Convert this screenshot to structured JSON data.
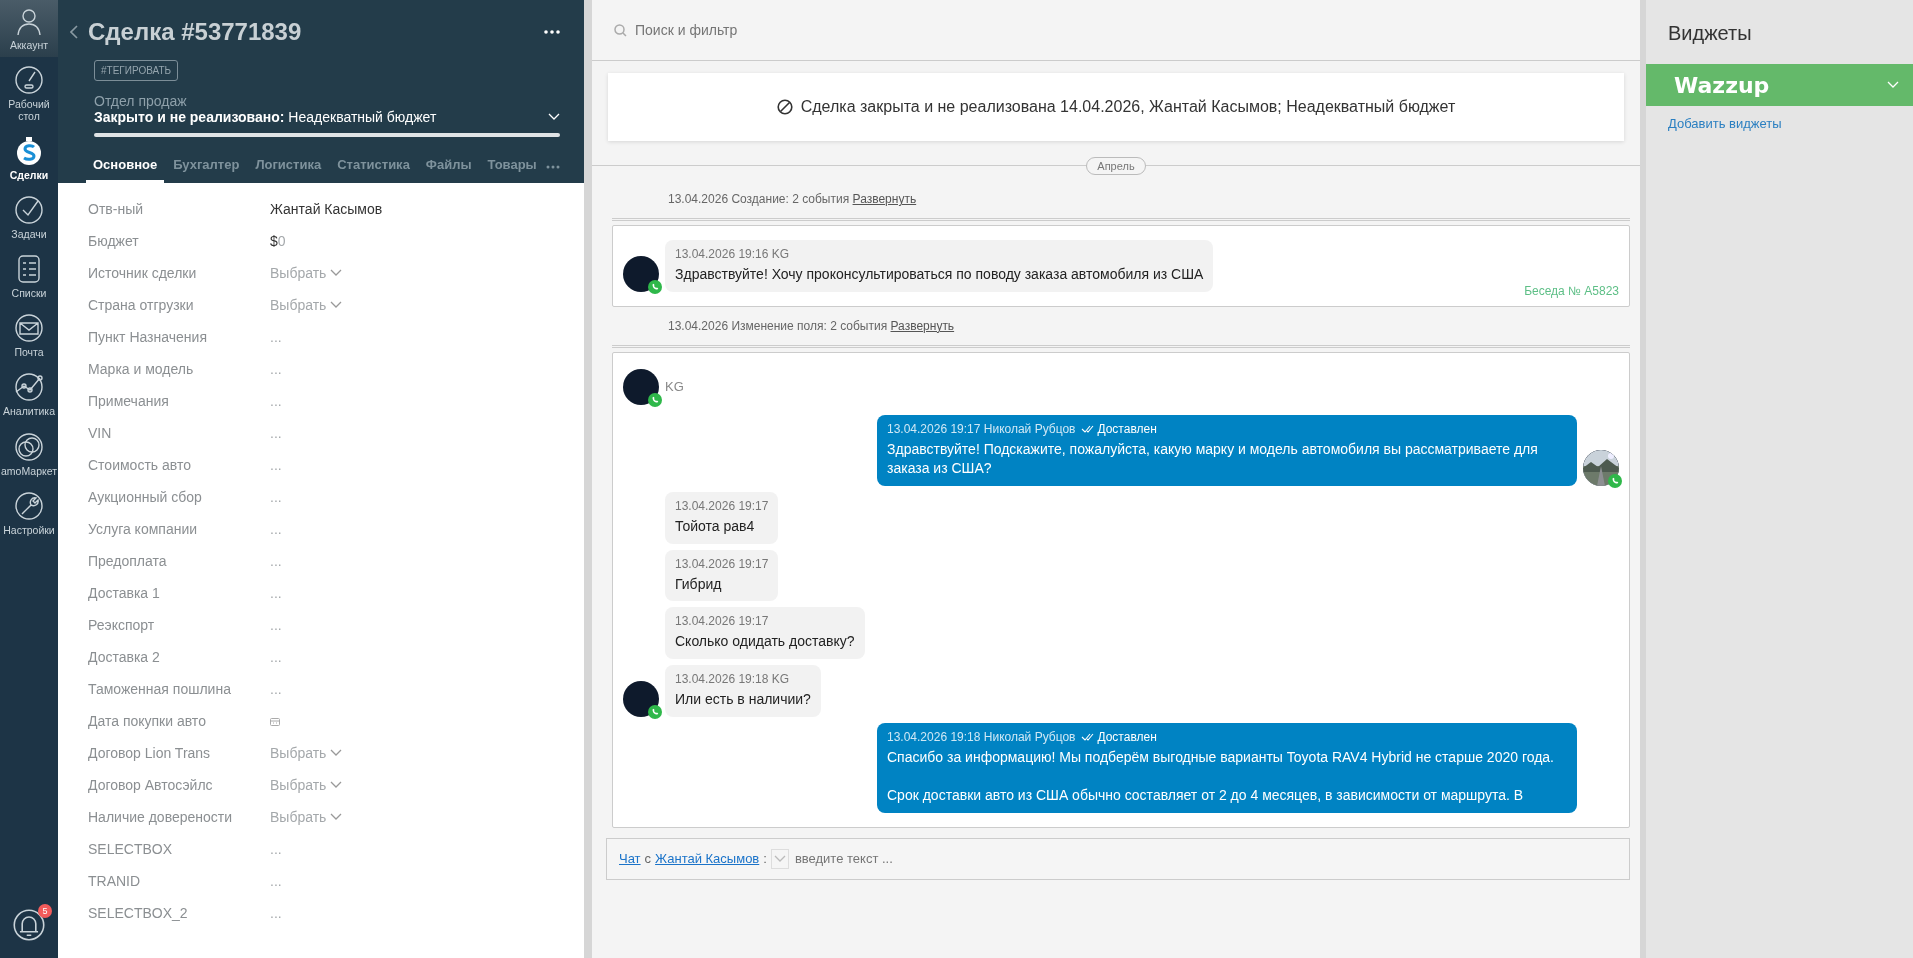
{
  "nav": {
    "items": [
      {
        "label": "Аккаунт",
        "kind": "account",
        "selected": false
      },
      {
        "label": "Рабочий стол",
        "kind": "dashboard",
        "selected": false
      },
      {
        "label": "Сделки",
        "kind": "deals",
        "selected": true
      },
      {
        "label": "Задачи",
        "kind": "tasks",
        "selected": false
      },
      {
        "label": "Списки",
        "kind": "lists",
        "selected": false
      },
      {
        "label": "Почта",
        "kind": "mail",
        "selected": false
      },
      {
        "label": "Аналитика",
        "kind": "analytics",
        "selected": false
      },
      {
        "label": "amoМаркет",
        "kind": "market",
        "selected": false
      },
      {
        "label": "Настройки",
        "kind": "settings",
        "selected": false
      }
    ],
    "notifications": {
      "badge": "5"
    }
  },
  "deal": {
    "title": "Сделка #53771839",
    "tag_button": "#ТЕГИРОВАТЬ",
    "pipeline": "Отдел продаж",
    "status": "**Закрыто и не реализовано:** Неадекватный бюджет",
    "tabs": [
      {
        "label": "Основное",
        "selected": true
      },
      {
        "label": "Бухгалтер",
        "selected": false
      },
      {
        "label": "Логистика",
        "selected": false
      },
      {
        "label": "Статистика",
        "selected": false
      },
      {
        "label": "Файлы",
        "selected": false
      },
      {
        "label": "Товары",
        "selected": false
      }
    ],
    "fields": [
      {
        "label": "Отв-ный",
        "kind": "text",
        "value": "Жантай Касымов"
      },
      {
        "label": "Бюджет",
        "kind": "money",
        "currency": "$",
        "value": "0"
      },
      {
        "label": "Источник сделки",
        "kind": "select",
        "value": "Выбрать"
      },
      {
        "label": "Страна отгрузки",
        "kind": "select",
        "value": "Выбрать"
      },
      {
        "label": "Пункт Назначения",
        "kind": "empty",
        "value": "..."
      },
      {
        "label": "Марка и модель",
        "kind": "empty",
        "value": "..."
      },
      {
        "label": "Примечания",
        "kind": "empty",
        "value": "..."
      },
      {
        "label": "VIN",
        "kind": "empty",
        "value": "..."
      },
      {
        "label": "Стоимость авто",
        "kind": "empty",
        "value": "..."
      },
      {
        "label": "Аукционный сбор",
        "kind": "empty",
        "value": "..."
      },
      {
        "label": "Услуга компании",
        "kind": "empty",
        "value": "..."
      },
      {
        "label": "Предоплата",
        "kind": "empty",
        "value": "..."
      },
      {
        "label": "Доставка 1",
        "kind": "empty",
        "value": "..."
      },
      {
        "label": "Реэкспорт",
        "kind": "empty",
        "value": "..."
      },
      {
        "label": "Доставка 2",
        "kind": "empty",
        "value": "..."
      },
      {
        "label": "Таможенная пошлина",
        "kind": "empty",
        "value": "..."
      },
      {
        "label": "Дата покупки авто",
        "kind": "date"
      },
      {
        "label": "Договор Lion Trans",
        "kind": "select",
        "value": "Выбрать"
      },
      {
        "label": "Договор Автосэйлс",
        "kind": "select",
        "value": "Выбрать"
      },
      {
        "label": "Наличие доверености",
        "kind": "select",
        "value": "Выбрать"
      },
      {
        "label": "SELECTBOX",
        "kind": "empty",
        "value": "..."
      },
      {
        "label": "TRANID",
        "kind": "empty",
        "value": "..."
      },
      {
        "label": "SELECTBOX_2",
        "kind": "empty",
        "value": "..."
      }
    ]
  },
  "feed": {
    "search": {
      "placeholder": "Поиск и фильтр"
    },
    "closed_banner": "Сделка закрыта и не реализована 14.04.2026, Жантай Касымов; Неадекватный бюджет",
    "month": "Апрель",
    "groups": [
      {
        "summary": "13.04.2026 Создание: 2 события",
        "expand": "Развернуть",
        "conversation": "Беседа № A5823",
        "messages": [
          {
            "kind": "in",
            "avatar": true,
            "meta": "13.04.2026 19:16 KG",
            "text": "Здравствуйте! Хочу проконсультироваться по поводу заказа автомобиля из США"
          }
        ]
      },
      {
        "summary": "13.04.2026 Изменение поля: 2 события",
        "expand": "Развернуть",
        "contact": "KG",
        "messages": [
          {
            "kind": "out",
            "avatar": true,
            "meta": "13.04.2026 19:17 Николай Рубцов",
            "status": "Доставлен",
            "text": "Здравствуйте! Подскажите, пожалуйста, какую марку и модель автомобиля вы рассматриваете для заказа из США?"
          },
          {
            "kind": "in",
            "avatar": false,
            "meta": "13.04.2026 19:17",
            "text": "Тойота рав4"
          },
          {
            "kind": "in",
            "avatar": false,
            "meta": "13.04.2026 19:17",
            "text": "Гибрид"
          },
          {
            "kind": "in",
            "avatar": false,
            "meta": "13.04.2026 19:17",
            "text": "Сколько одидать доставку?"
          },
          {
            "kind": "in",
            "avatar": true,
            "meta": "13.04.2026 19:18 KG",
            "text": "Или есть в наличии?"
          },
          {
            "kind": "out",
            "avatar": false,
            "meta": "13.04.2026 19:18 Николай Рубцов",
            "status": "Доставлен",
            "text": "Спасибо за информацию! Мы подберём выгодные варианты Toyota RAV4 Hybrid не старше 2020 года.",
            "text2": "Срок доставки авто из США обычно составляет от 2 до 4 месяцев, в зависимости от маршрута. В"
          }
        ]
      }
    ],
    "chat_input": {
      "link": "Чат",
      "connector": "с",
      "contact": "Жантай Касымов",
      "colon": ":",
      "placeholder": "введите текст ..."
    }
  },
  "widgets": {
    "title": "Виджеты",
    "items": [
      {
        "name": "Wazzup"
      }
    ],
    "add_link": "Добавить виджеты"
  }
}
